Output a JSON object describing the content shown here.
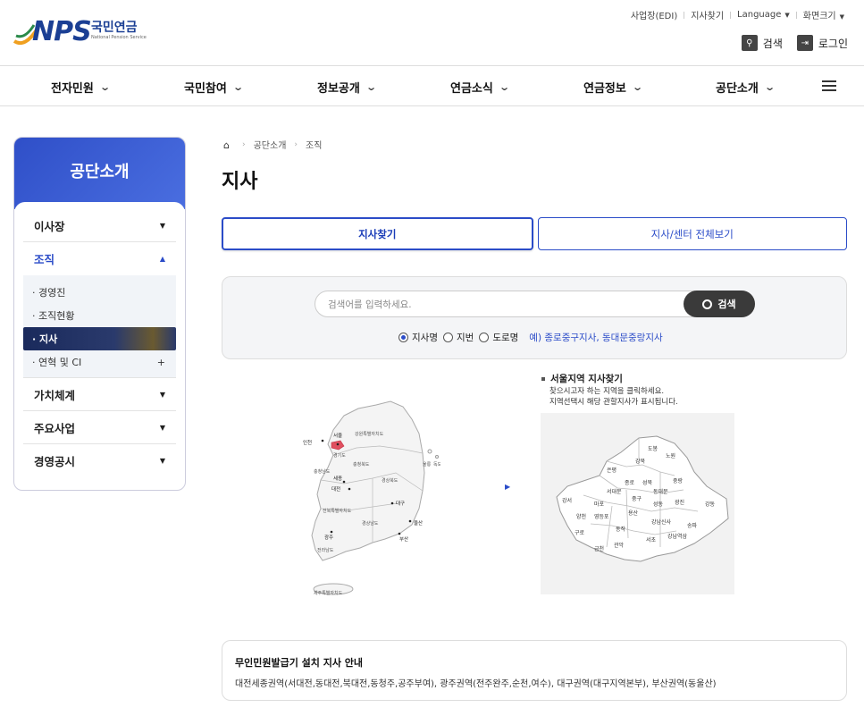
{
  "header": {
    "logo_mark": "NPS",
    "logo_ko": "국민연금",
    "logo_en": "National Pension Service",
    "util_links": [
      "사업장(EDI)",
      "지사찾기",
      "Language",
      "화면크기"
    ],
    "search_label": "검색",
    "login_label": "로그인"
  },
  "gnb": {
    "items": [
      "전자민원",
      "국민참여",
      "정보공개",
      "연금소식",
      "연금정보",
      "공단소개"
    ]
  },
  "lnb": {
    "title": "공단소개",
    "items": [
      "이사장",
      "조직",
      "가치체계",
      "주요사업",
      "경영공시"
    ],
    "sub_items": [
      "경영진",
      "조직현황",
      "지사",
      "연혁 및 CI"
    ]
  },
  "breadcrumb": [
    "공단소개",
    "조직"
  ],
  "page_title": "지사",
  "tabs": [
    "지사찾기",
    "지사/센터 전체보기"
  ],
  "search": {
    "placeholder": "검색어를 입력하세요.",
    "button_label": "검색",
    "options": [
      "지사명",
      "지번",
      "도로명"
    ],
    "selected": "지사명",
    "example": "예) 종로중구지사, 동대문중랑지사"
  },
  "korea_map": {
    "labels": [
      "서울",
      "인천",
      "경기도",
      "강원특별자치도",
      "충청북도",
      "충청남도",
      "세종",
      "대전",
      "경상북도",
      "대구",
      "전북특별자치도",
      "경상남도",
      "울산",
      "부산",
      "광주",
      "전라남도",
      "제주특별자치도",
      "울릉",
      "독도"
    ]
  },
  "seoul_map": {
    "title": "서울지역 지사찾기",
    "desc_1": "찾으시고자 하는 지역을 클릭하세요.",
    "desc_2": "지역선택시 해당 관할지사가 표시됩니다.",
    "labels": [
      "도봉",
      "노원",
      "강북",
      "은평",
      "성북",
      "중랑",
      "종로",
      "동대문",
      "서대문",
      "마포",
      "중구",
      "성동",
      "광진",
      "강서",
      "용산",
      "양천",
      "영등포",
      "강남신사",
      "송파",
      "강동",
      "구로",
      "동작",
      "서초",
      "강남역삼",
      "관악",
      "금천"
    ]
  },
  "notice": {
    "title": "무인민원발급기 설치 지사 안내",
    "text": "대전세종권역(서대전,동대전,북대전,동청주,공주부여), 광주권역(전주완주,순천,여수), 대구권역(대구지역본부), 부산권역(동울산)"
  },
  "colors": {
    "brand_blue": "#2b4cc8",
    "nav_dark": "#1a2a5c",
    "seoul_highlight": "#e05060"
  }
}
